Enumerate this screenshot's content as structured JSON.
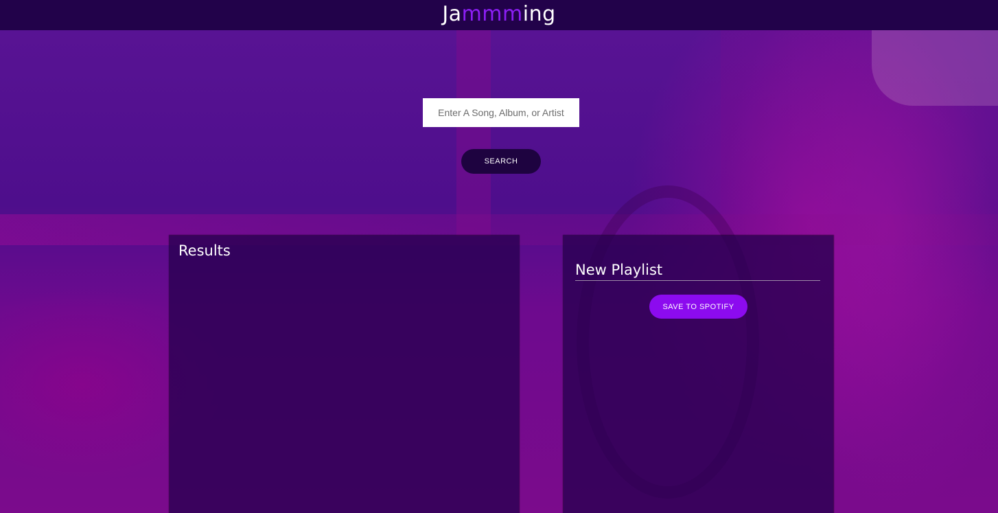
{
  "header": {
    "logo_prefix": "Ja",
    "logo_highlight": "mmm",
    "logo_suffix": "ing"
  },
  "search": {
    "placeholder": "Enter A Song, Album, or Artist",
    "value": "",
    "button_label": "SEARCH"
  },
  "results": {
    "title": "Results",
    "tracks": []
  },
  "playlist": {
    "name": "New Playlist",
    "tracks": [],
    "save_label": "SAVE TO SPOTIFY"
  },
  "colors": {
    "header_bg": "#22024a",
    "logo_accent": "#8c1ef5",
    "search_button_bg": "#1e0340",
    "save_button_bg": "#8c0bef",
    "background_purple": "#5a1495",
    "background_magenta": "#7b0b8c"
  }
}
